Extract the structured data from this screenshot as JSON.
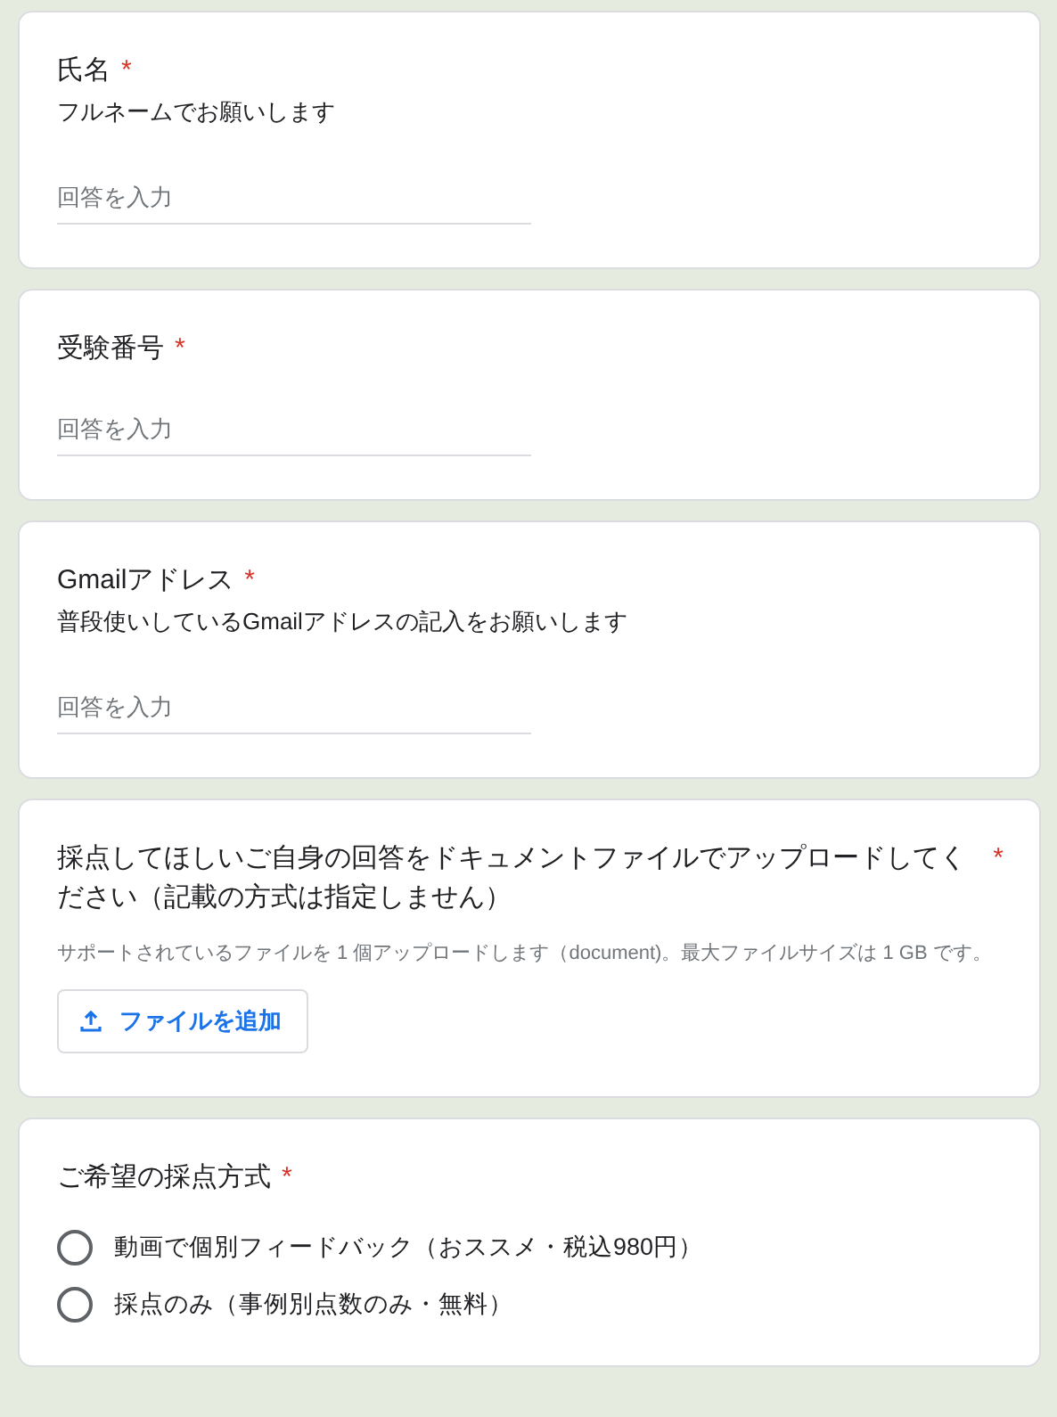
{
  "questions": [
    {
      "kind": "text",
      "title": "氏名",
      "required_mark": "*",
      "description": "フルネームでお願いします",
      "placeholder": "回答を入力"
    },
    {
      "kind": "text",
      "title": "受験番号",
      "required_mark": "*",
      "placeholder": "回答を入力"
    },
    {
      "kind": "text",
      "title": "Gmailアドレス",
      "required_mark": "*",
      "description": "普段使いしているGmailアドレスの記入をお願いします",
      "placeholder": "回答を入力"
    },
    {
      "kind": "file",
      "title": "採点してほしいご自身の回答をドキュメントファイルでアップロードしてください（記載の方式は指定しません）",
      "required_mark": "*",
      "note": "サポートされているファイルを 1 個アップロードします（document)。最大ファイルサイズは 1 GB です。",
      "button": "ファイルを追加"
    },
    {
      "kind": "radio",
      "title": "ご希望の採点方式",
      "required_mark": "*",
      "options": [
        {
          "label": "動画で個別フィードバック（おススメ・税込980円）",
          "selected": false
        },
        {
          "label": "採点のみ（事例別点数のみ・無料）",
          "selected": false
        }
      ]
    }
  ]
}
